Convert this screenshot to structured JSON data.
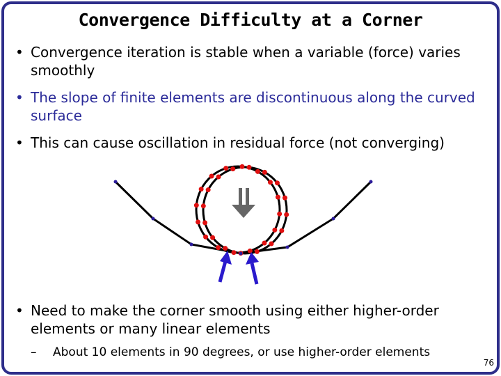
{
  "slide": {
    "title": "Convergence Difficulty at a Corner",
    "bullets": [
      {
        "marker": "•",
        "text": "Convergence iteration is stable when a variable (force) varies smoothly"
      },
      {
        "marker": "•",
        "text": "The slope of finite elements are discontinuous along the curved surface",
        "color": "#2b2b99"
      },
      {
        "marker": "•",
        "text": "This can cause oscillation in residual force (not converging)"
      },
      {
        "marker": "•",
        "text": "Need to make the corner smooth using either higher-order elements or many linear elements"
      }
    ],
    "sub_bullet": {
      "marker": "–",
      "text": "About 10 elements in 90 degrees, or use higher-order elements"
    },
    "page_number": "76"
  },
  "figure": {
    "description": "Circle contacting a polyline corner made of linear finite elements; two circle positions shown with red nodes, a gray downward double arrow, and two blue contact force arrows",
    "colors": {
      "surface_line": "#000000",
      "surface_nodes": "#2a1a9a",
      "circle_nodes": "#e01010",
      "load_arrow": "#666666",
      "contact_arrows": "#2a1acc",
      "frame": "#2e2e8a"
    }
  }
}
